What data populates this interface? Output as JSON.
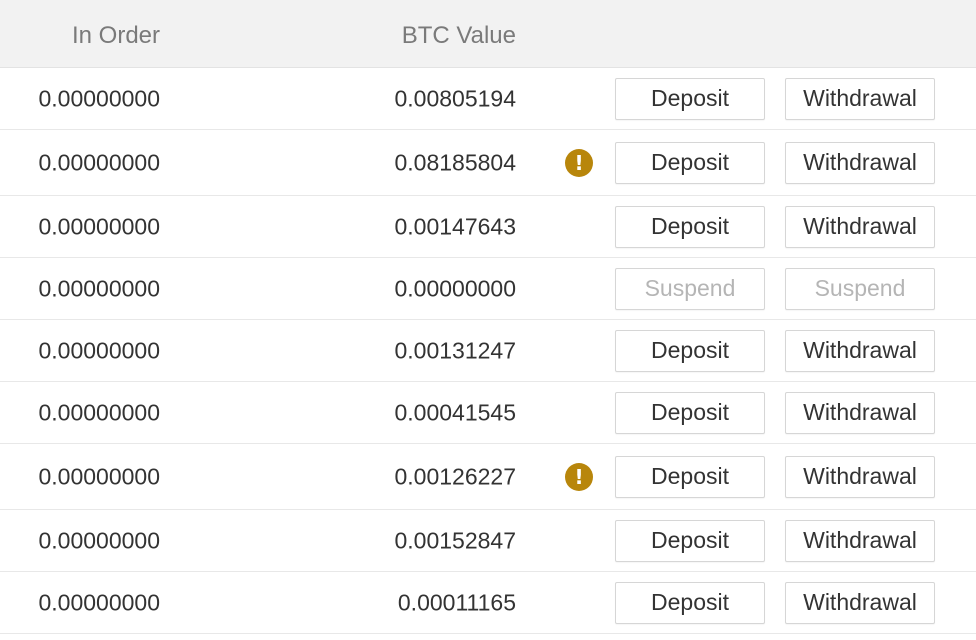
{
  "header": {
    "in_order": "In Order",
    "btc_value": "BTC Value"
  },
  "rows": [
    {
      "in_order": "0.00000000",
      "btc_value": "0.00805194",
      "deposit": "Deposit",
      "withdrawal": "Withdrawal"
    },
    {
      "in_order": "0.00000000",
      "btc_value": "0.08185804",
      "warning": "!",
      "deposit": "Deposit",
      "withdrawal": "Withdrawal"
    },
    {
      "in_order": "0.00000000",
      "btc_value": "0.00147643",
      "deposit": "Deposit",
      "withdrawal": "Withdrawal"
    },
    {
      "in_order": "0.00000000",
      "btc_value": "0.00000000",
      "deposit": "Suspend",
      "withdrawal": "Suspend"
    },
    {
      "in_order": "0.00000000",
      "btc_value": "0.00131247",
      "deposit": "Deposit",
      "withdrawal": "Withdrawal"
    },
    {
      "in_order": "0.00000000",
      "btc_value": "0.00041545",
      "deposit": "Deposit",
      "withdrawal": "Withdrawal"
    },
    {
      "in_order": "0.00000000",
      "btc_value": "0.00126227",
      "warning": "!",
      "deposit": "Deposit",
      "withdrawal": "Withdrawal"
    },
    {
      "in_order": "0.00000000",
      "btc_value": "0.00152847",
      "deposit": "Deposit",
      "withdrawal": "Withdrawal"
    },
    {
      "in_order": "0.00000000",
      "btc_value": "0.00011165",
      "deposit": "Deposit",
      "withdrawal": "Withdrawal"
    }
  ],
  "colors": {
    "warning_icon": "#b8860b",
    "header_bg": "#f2f2f2",
    "disabled_text": "#b5b5b5"
  },
  "icons": {
    "warning": "exclamation-circle-icon"
  }
}
